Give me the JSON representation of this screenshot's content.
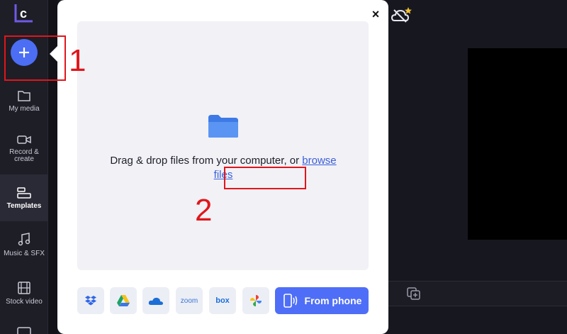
{
  "sidebar": {
    "items": [
      {
        "label": "My media",
        "icon": "folder-icon"
      },
      {
        "label": "Record & create",
        "icon": "camera-icon"
      },
      {
        "label": "Templates",
        "icon": "templates-icon",
        "active": true
      },
      {
        "label": "Music & SFX",
        "icon": "music-note-icon"
      },
      {
        "label": "Stock video",
        "icon": "film-icon"
      }
    ]
  },
  "modal": {
    "close_label": "×",
    "drop_text": "Drag & drop files from your computer, or ",
    "browse_link": "browse files",
    "sources": [
      {
        "name": "dropbox",
        "icon": "dropbox-icon"
      },
      {
        "name": "google-drive",
        "icon": "google-drive-icon"
      },
      {
        "name": "onedrive",
        "icon": "onedrive-icon"
      },
      {
        "name": "zoom",
        "label": "zoom"
      },
      {
        "name": "box",
        "label": "box"
      },
      {
        "name": "google-photos",
        "icon": "google-photos-icon"
      }
    ],
    "from_phone_label": "From phone"
  },
  "annotations": {
    "step1": "1",
    "step2": "2",
    "color": "#e0161b"
  },
  "colors": {
    "accent": "#4b6ef5",
    "link": "#3b5fd9"
  }
}
